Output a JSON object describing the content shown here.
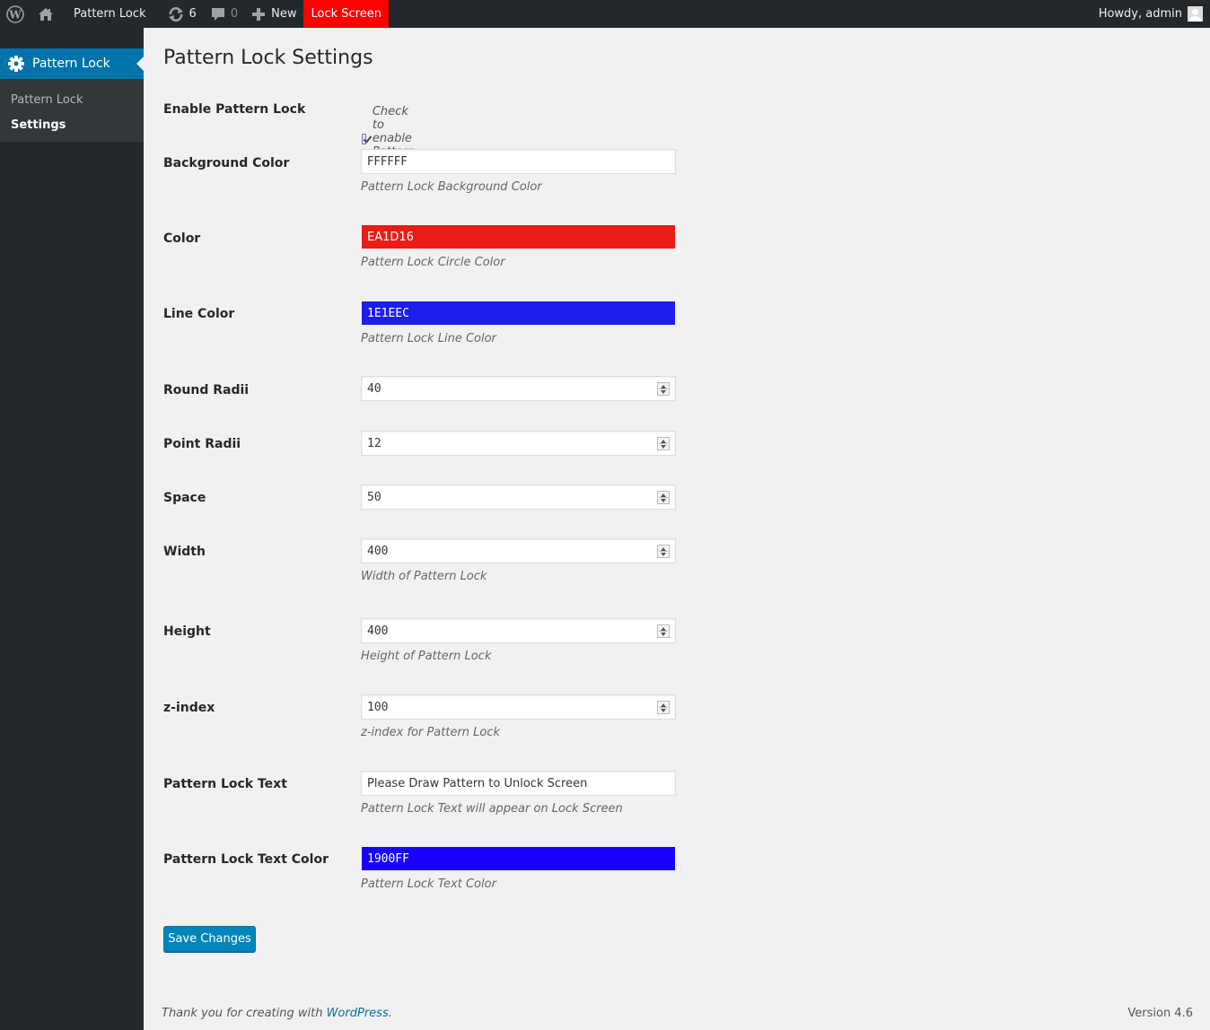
{
  "adminbar": {
    "site_name": "Pattern Lock",
    "updates_count": "6",
    "comments_count": "0",
    "new_label": "New",
    "lock_screen_label": "Lock Screen",
    "howdy": "Howdy, admin",
    "lock_screen_bg": "#ff0000"
  },
  "sidebar": {
    "menu_label": "Pattern Lock",
    "submenu": [
      {
        "label": "Pattern Lock",
        "current": false
      },
      {
        "label": "Settings",
        "current": true
      }
    ]
  },
  "page": {
    "title": "Pattern Lock Settings"
  },
  "form": {
    "enable": {
      "label": "Enable Pattern Lock",
      "checked": true,
      "check_text": "Check to enable Pattern Lock"
    },
    "background_color": {
      "label": "Background Color",
      "value": "FFFFFF",
      "description": "Pattern Lock Background Color"
    },
    "color": {
      "label": "Color",
      "value": "EA1D16",
      "description": "Pattern Lock Circle Color",
      "swatch": "#ea1d16"
    },
    "line_color": {
      "label": "Line Color",
      "value": "1E1EEC",
      "description": "Pattern Lock Line Color",
      "swatch": "#1e1eec"
    },
    "round_radii": {
      "label": "Round Radii",
      "value": "40"
    },
    "point_radii": {
      "label": "Point Radii",
      "value": "12"
    },
    "space": {
      "label": "Space",
      "value": "50"
    },
    "width": {
      "label": "Width",
      "value": "400",
      "description": "Width of Pattern Lock"
    },
    "height": {
      "label": "Height",
      "value": "400",
      "description": "Height of Pattern Lock"
    },
    "zindex": {
      "label": "z-index",
      "value": "100",
      "description": "z-index for Pattern Lock"
    },
    "text": {
      "label": "Pattern Lock Text",
      "value": "Please Draw Pattern to Unlock Screen",
      "description": "Pattern Lock Text will appear on Lock Screen"
    },
    "text_color": {
      "label": "Pattern Lock Text Color",
      "value": "1900FF",
      "description": "Pattern Lock Text Color",
      "swatch": "#1900ff"
    },
    "save_label": "Save Changes"
  },
  "footer": {
    "thanks_prefix": "Thank you for creating with ",
    "link_text": "WordPress",
    "thanks_suffix": ".",
    "version": "Version 4.6"
  }
}
